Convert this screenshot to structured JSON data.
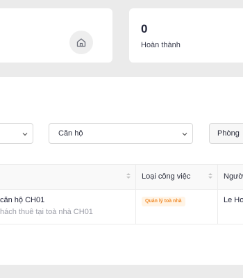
{
  "stats": {
    "completed_value": "0",
    "completed_label": "Hoàn thành"
  },
  "filters": {
    "apartment_label": "Căn hộ",
    "room_label": "Phòng"
  },
  "table": {
    "columns": [
      "Loại công việc",
      "Ngườ"
    ],
    "rows": [
      {
        "title": "căn hộ CH01",
        "subtitle": "hách thuê tại toà nhà CH01",
        "task_type": "Quản lý toà nhà",
        "person": "Le Ho"
      }
    ]
  },
  "colors": {
    "badge_bg": "#fff4e6",
    "badge_text": "#f08c2c"
  },
  "icons": [
    "home-icon",
    "chevron-down-icon",
    "sort-icon"
  ]
}
